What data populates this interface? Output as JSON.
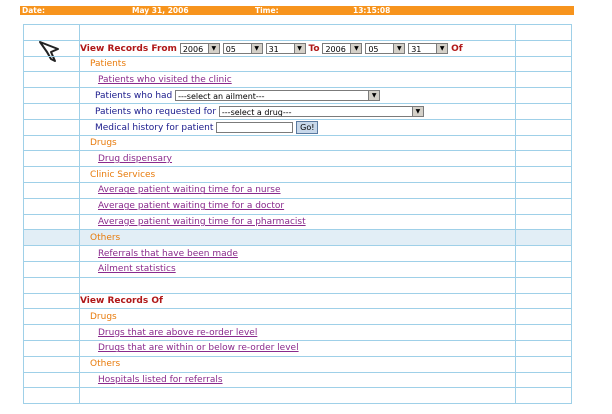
{
  "header": {
    "date_label": "Date:",
    "date_value": "May 31, 2006",
    "time_label": "Time:",
    "time_value": "13:15:08"
  },
  "view_from": {
    "label": "View Records From",
    "from_year": "2006",
    "from_month": "05",
    "from_day": "31",
    "to_label": "To",
    "to_year": "2006",
    "to_month": "05",
    "to_day": "31",
    "of_label": "Of"
  },
  "patients": {
    "heading": "Patients",
    "visited_link": "Patients who visited the clinic",
    "had_label": "Patients who had",
    "ailment_select": "---select an ailment---",
    "requested_label": "Patients who requested for",
    "drug_select": "---select a drug---",
    "history_label": "Medical history for patient",
    "history_input": "",
    "go_button": "Go!"
  },
  "drugs": {
    "heading": "Drugs",
    "dispensary_link": "Drug dispensary"
  },
  "clinic_services": {
    "heading": "Clinic Services",
    "nurse_link": "Average patient waiting time for a nurse",
    "doctor_link": "Average patient waiting time for a doctor",
    "pharmacist_link": "Average patient waiting time for a pharmacist"
  },
  "others": {
    "heading": "Others",
    "referrals_link": "Referrals that have been made",
    "ailment_link": "Ailment statistics"
  },
  "view_of": {
    "label": "View Records Of",
    "drugs_heading": "Drugs",
    "above_link": "Drugs that are above re-order level",
    "below_link": "Drugs that are within or below re-order level",
    "others_heading": "Others",
    "hospitals_link": "Hospitals listed for referrals"
  },
  "icons": {
    "logo": "pointer-arrow-icon"
  },
  "colors": {
    "header_bg": "#f7941d",
    "heading_red": "#b01818",
    "section_orange": "#e87b0c",
    "link_purple": "#8a2a8c",
    "grid_line": "#9fd0e8",
    "highlight_row": "#e2eef6"
  }
}
